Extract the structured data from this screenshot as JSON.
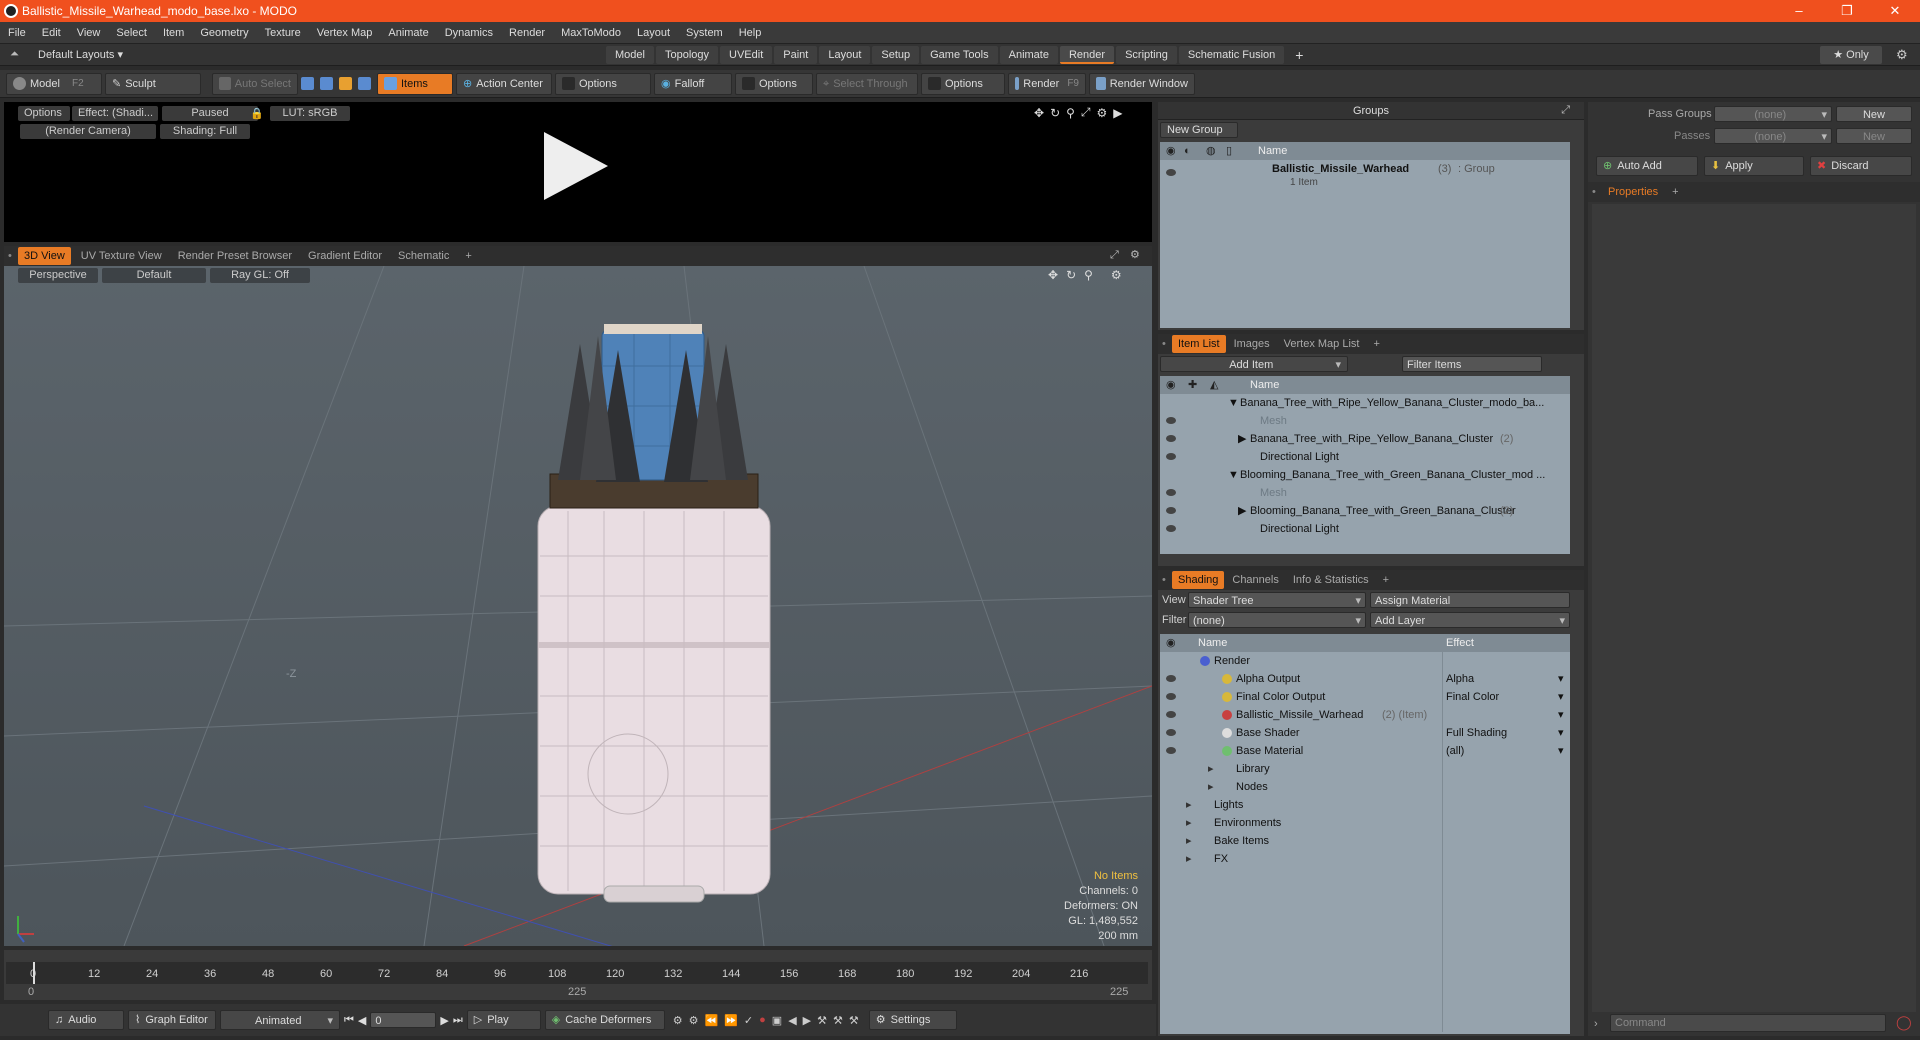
{
  "window": {
    "title": "Ballistic_Missile_Warhead_modo_base.lxo - MODO",
    "min": "–",
    "restore": "❐",
    "close": "✕"
  },
  "menu": [
    "File",
    "Edit",
    "View",
    "Select",
    "Item",
    "Geometry",
    "Texture",
    "Vertex Map",
    "Animate",
    "Dynamics",
    "Render",
    "MaxToModo",
    "Layout",
    "System",
    "Help"
  ],
  "layoutbar": {
    "layouts": "Default Layouts ▾",
    "tabs": [
      "Model",
      "Topology",
      "UVEdit",
      "Paint",
      "Layout",
      "Setup",
      "Game Tools",
      "Animate",
      "Render",
      "Scripting",
      "Schematic Fusion"
    ],
    "active": "Render",
    "plus": "+",
    "only": "★ Only"
  },
  "toolbar": {
    "model": "Model",
    "model_key": "F2",
    "sculpt": "Sculpt",
    "auto_select": "Auto Select",
    "items": "Items",
    "action_center": "Action Center",
    "options1": "Options",
    "falloff": "Falloff",
    "options2": "Options",
    "select_through": "Select Through",
    "options3": "Options",
    "render": "Render",
    "render_key": "F9",
    "render_window": "Render Window"
  },
  "preview": {
    "options": "Options",
    "effect": "Effect: (Shadi...",
    "paused": "Paused",
    "lut": "LUT: sRGB",
    "camera": "(Render Camera)",
    "shading": "Shading: Full"
  },
  "viewport_tabs": {
    "tabs": [
      "3D View",
      "UV Texture View",
      "Render Preset Browser",
      "Gradient Editor",
      "Schematic"
    ],
    "plus": "+"
  },
  "viewport": {
    "perspective": "Perspective",
    "default": "Default",
    "raygl": "Ray GL: Off",
    "axis_label": "-Z",
    "stats": {
      "no_items": "No Items",
      "channels": "Channels: 0",
      "deformers": "Deformers: ON",
      "gl": "GL: 1,489,552",
      "scale": "200 mm"
    }
  },
  "timeline": {
    "ticks": [
      "0",
      "12",
      "24",
      "36",
      "48",
      "60",
      "72",
      "84",
      "96",
      "108",
      "120",
      "132",
      "144",
      "156",
      "168",
      "180",
      "192",
      "204",
      "216"
    ],
    "sub_left": "0",
    "sub_mid": "225",
    "sub_right": "225"
  },
  "bottombar": {
    "audio": "Audio",
    "graph_editor": "Graph Editor",
    "animated": "Animated",
    "frame": "0",
    "play": "Play",
    "cache": "Cache Deformers",
    "settings": "Settings"
  },
  "groups": {
    "header": "Groups",
    "new_group": "New Group",
    "col_name": "Name",
    "item_name": "Ballistic_Missile_Warhead",
    "item_count": "(3)",
    "item_type": ": Group",
    "item_sub": "1 Item"
  },
  "itemlist": {
    "tabs": [
      "Item List",
      "Images",
      "Vertex Map List"
    ],
    "plus": "+",
    "add_item": "Add Item",
    "filter": "Filter Items",
    "col_name": "Name",
    "rows": [
      {
        "text": "Banana_Tree_with_Ripe_Yellow_Banana_Cluster_modo_ba...",
        "indent": 0,
        "dim": false,
        "count": ""
      },
      {
        "text": "Mesh",
        "indent": 2,
        "dim": true,
        "count": ""
      },
      {
        "text": "Banana_Tree_with_Ripe_Yellow_Banana_Cluster",
        "indent": 1,
        "dim": false,
        "count": "(2)"
      },
      {
        "text": "Directional Light",
        "indent": 2,
        "dim": false,
        "count": ""
      },
      {
        "text": "Blooming_Banana_Tree_with_Green_Banana_Cluster_mod ...",
        "indent": 0,
        "dim": false,
        "count": ""
      },
      {
        "text": "Mesh",
        "indent": 2,
        "dim": true,
        "count": ""
      },
      {
        "text": "Blooming_Banana_Tree_with_Green_Banana_Cluster",
        "indent": 1,
        "dim": false,
        "count": "(2)"
      },
      {
        "text": "Directional Light",
        "indent": 2,
        "dim": false,
        "count": ""
      }
    ]
  },
  "shading": {
    "tabs": [
      "Shading",
      "Channels",
      "Info & Statistics"
    ],
    "plus": "+",
    "view_label": "View",
    "view_value": "Shader Tree",
    "assign": "Assign Material",
    "filter_label": "Filter",
    "filter_value": "(none)",
    "add_layer": "Add Layer",
    "col_name": "Name",
    "col_effect": "Effect",
    "rows": [
      {
        "name": "Render",
        "effect": "",
        "indent": 0,
        "color": "#4a5fd0",
        "eye": false
      },
      {
        "name": "Alpha Output",
        "effect": "Alpha",
        "indent": 1,
        "color": "#d8b83a",
        "eye": true
      },
      {
        "name": "Final Color Output",
        "effect": "Final Color",
        "indent": 1,
        "color": "#d8b83a",
        "eye": true
      },
      {
        "name": "Ballistic_Missile_Warhead",
        "effect": "",
        "indent": 1,
        "color": "#c84040",
        "eye": true,
        "suffix": "(2) (Item)"
      },
      {
        "name": "Base Shader",
        "effect": "Full Shading",
        "indent": 1,
        "color": "#dddddd",
        "eye": true
      },
      {
        "name": "Base Material",
        "effect": "(all)",
        "indent": 1,
        "color": "#6fbf6f",
        "eye": true
      },
      {
        "name": "Library",
        "effect": "",
        "indent": 1,
        "color": "",
        "eye": false
      },
      {
        "name": "Nodes",
        "effect": "",
        "indent": 1,
        "color": "",
        "eye": false
      },
      {
        "name": "Lights",
        "effect": "",
        "indent": 0,
        "color": "",
        "eye": false
      },
      {
        "name": "Environments",
        "effect": "",
        "indent": 0,
        "color": "",
        "eye": false
      },
      {
        "name": "Bake Items",
        "effect": "",
        "indent": 0,
        "color": "",
        "eye": false
      },
      {
        "name": "FX",
        "effect": "",
        "indent": 0,
        "color": "",
        "eye": false
      }
    ]
  },
  "passes": {
    "pass_groups": "Pass Groups",
    "passes": "Passes",
    "none1": "(none)",
    "none2": "(none)",
    "new1": "New",
    "new2": "New",
    "auto_add": "Auto Add",
    "apply": "Apply",
    "discard": "Discard",
    "properties": "Properties",
    "plus": "+",
    "command": "Command"
  }
}
